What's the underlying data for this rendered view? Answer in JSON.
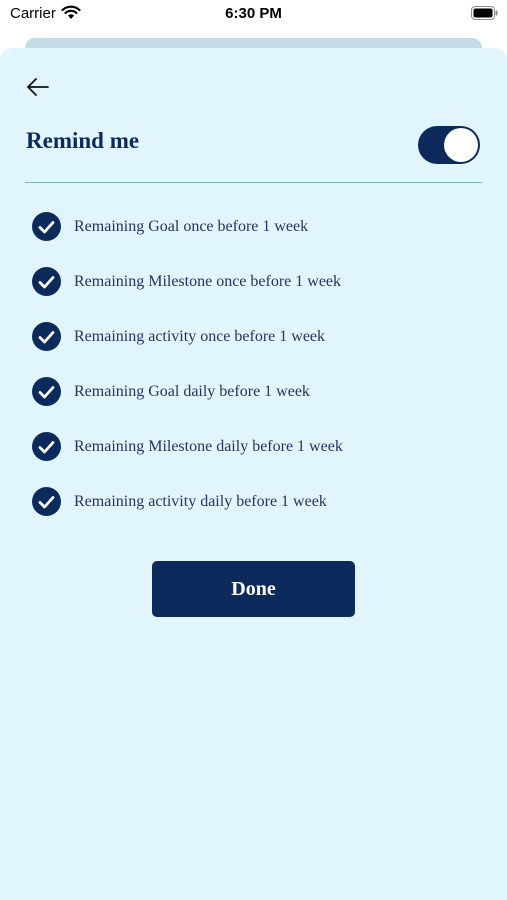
{
  "status_bar": {
    "carrier": "Carrier",
    "time": "6:30 PM"
  },
  "header": {
    "title": "Remind me",
    "toggle_on": true
  },
  "options": [
    {
      "label": "Remaining Goal once before 1 week",
      "checked": true
    },
    {
      "label": "Remaining Milestone once before 1 week",
      "checked": true
    },
    {
      "label": "Remaining activity once before 1 week",
      "checked": true
    },
    {
      "label": "Remaining Goal daily before 1 week",
      "checked": true
    },
    {
      "label": "Remaining Milestone daily before 1 week",
      "checked": true
    },
    {
      "label": "Remaining activity daily before 1 week",
      "checked": true
    }
  ],
  "actions": {
    "done_label": "Done"
  },
  "colors": {
    "primary": "#0d2a5c",
    "sheet_background": "#e1f5fd",
    "divider": "#7fb4c4"
  },
  "icons": {
    "back": "arrow-left-icon",
    "check": "check-circle-icon",
    "wifi": "wifi-icon",
    "battery": "battery-icon"
  }
}
